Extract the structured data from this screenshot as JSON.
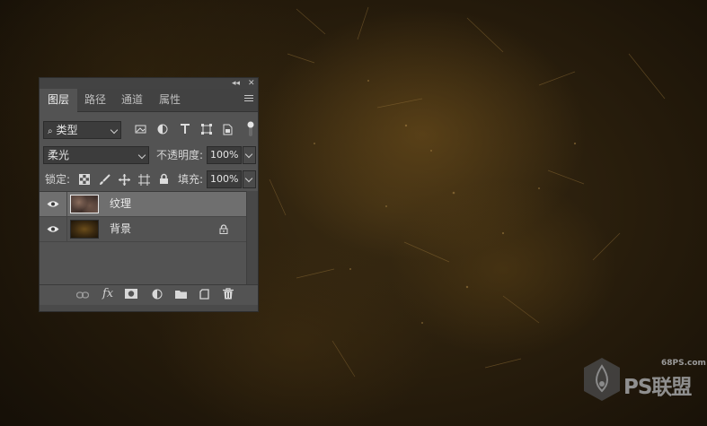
{
  "panel": {
    "tabs": [
      {
        "label": "图层",
        "active": true
      },
      {
        "label": "路径",
        "active": false
      },
      {
        "label": "通道",
        "active": false
      },
      {
        "label": "属性",
        "active": false
      }
    ],
    "filter": {
      "label": "类型",
      "icon": "search-icon"
    },
    "filter_icons": [
      "image-filter-icon",
      "adjustment-filter-icon",
      "type-filter-icon",
      "shape-filter-icon",
      "smart-object-filter-icon"
    ],
    "blend_mode": "柔光",
    "opacity_label": "不透明度:",
    "opacity_value": "100%",
    "lock_label": "锁定:",
    "lock_icons": [
      "lock-transparent-pixels-icon",
      "lock-image-pixels-icon",
      "lock-position-icon",
      "lock-artboard-icon",
      "lock-all-icon"
    ],
    "fill_label": "填充:",
    "fill_value": "100%",
    "layers": [
      {
        "name": "纹理",
        "visible": true,
        "selected": true,
        "locked": false
      },
      {
        "name": "背景",
        "visible": true,
        "selected": false,
        "locked": true
      }
    ],
    "bottom_icons": [
      "link-layers-icon",
      "fx-icon",
      "add-mask-icon",
      "new-adjustment-layer-icon",
      "new-group-icon",
      "new-layer-icon",
      "delete-layer-icon"
    ],
    "fx_label": "fx"
  },
  "watermark": {
    "url": "68PS.com",
    "text": "PS联盟"
  },
  "colors": {
    "panel_bg": "#535353",
    "tab_bar": "#424242",
    "selected_row": "#6f6f6f",
    "canvas_gold": "#3a2b12"
  }
}
